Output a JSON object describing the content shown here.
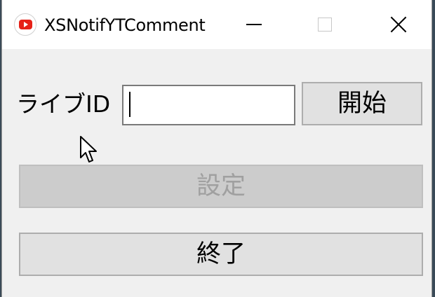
{
  "window": {
    "title": "XSNotifYTComment",
    "icon": "youtube-icon"
  },
  "titlebar_buttons": {
    "minimize": "minimize-icon",
    "maximize": "maximize-icon",
    "close": "close-icon"
  },
  "form": {
    "live_id_label": "ライブID",
    "live_id_value": "",
    "start_label": "開始",
    "settings_label": "設定",
    "exit_label": "終了"
  },
  "colors": {
    "window_bg": "#f0f0f0",
    "titlebar_bg": "#ffffff",
    "button_bg": "#e1e1e1",
    "disabled_button_bg": "#cccccc",
    "disabled_text": "#a0a0a0",
    "youtube_red": "#e62117"
  }
}
